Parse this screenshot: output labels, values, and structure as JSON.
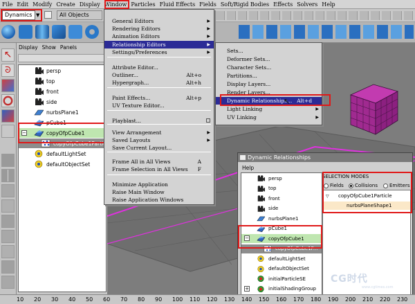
{
  "menubar": {
    "items": [
      "File",
      "Edit",
      "Modify",
      "Create",
      "Display",
      "Window",
      "Particles",
      "Fluid Effects",
      "Fields",
      "Soft/Rigid Bodies",
      "Effects",
      "Solvers",
      "Help"
    ]
  },
  "toolbar": {
    "mode_value": "Dynamics",
    "selection_mask": "All Objects"
  },
  "outliner": {
    "menu": [
      "Display",
      "Show",
      "Panels"
    ],
    "items": [
      {
        "label": "persp",
        "icon": "camera-icon"
      },
      {
        "label": "top",
        "icon": "camera-icon"
      },
      {
        "label": "front",
        "icon": "camera-icon"
      },
      {
        "label": "side",
        "icon": "camera-icon"
      },
      {
        "label": "nurbsPlane1",
        "icon": "nurbs-plane-icon"
      },
      {
        "label": "pCube1",
        "icon": "poly-mesh-icon"
      },
      {
        "label": "copyOfpCube1",
        "icon": "poly-mesh-icon",
        "expander": "−"
      },
      {
        "label": "copyOfpCube1Particle",
        "icon": "particle-icon"
      },
      {
        "label": "defaultLightSet",
        "icon": "set-icon"
      },
      {
        "label": "defaultObjectSet",
        "icon": "set-icon"
      }
    ]
  },
  "window_menu": {
    "items": [
      {
        "label": "General Editors",
        "submenu": true
      },
      {
        "label": "Rendering Editors",
        "submenu": true
      },
      {
        "label": "Animation Editors",
        "submenu": true
      },
      {
        "label": "Relationship Editors",
        "submenu": true,
        "highlighted": true
      },
      {
        "label": "Settings/Preferences",
        "submenu": true
      },
      {
        "label": "Attribute Editor..."
      },
      {
        "label": "Outliner...",
        "shortcut": "Alt+o"
      },
      {
        "label": "Hypergraph...",
        "shortcut": "Alt+h"
      },
      {
        "label": "Paint Effects...",
        "shortcut": "Alt+p"
      },
      {
        "label": "UV Texture Editor..."
      },
      {
        "label": "Playblast...",
        "option_box": true
      },
      {
        "label": "View Arrangement",
        "submenu": true
      },
      {
        "label": "Saved Layouts",
        "submenu": true
      },
      {
        "label": "Save Current Layout..."
      },
      {
        "label": "Frame All in All Views",
        "shortcut": "A"
      },
      {
        "label": "Frame Selection in All Views",
        "shortcut": "F"
      },
      {
        "label": "Minimize Application"
      },
      {
        "label": "Raise Main Window"
      },
      {
        "label": "Raise Application Windows"
      }
    ]
  },
  "relationship_submenu": {
    "items": [
      {
        "label": "Sets..."
      },
      {
        "label": "Deformer Sets..."
      },
      {
        "label": "Character Sets..."
      },
      {
        "label": "Partitions..."
      },
      {
        "label": "Display Layers..."
      },
      {
        "label": "Render Layers..."
      },
      {
        "label": "Dynamic Relationships...",
        "shortcut": "Alt+d",
        "highlighted": true
      },
      {
        "label": "Light Linking",
        "submenu": true
      },
      {
        "label": "UV Linking",
        "submenu": true
      }
    ]
  },
  "dynamic_window": {
    "title": "Dynamic Relationships",
    "menu_help": "Help",
    "list": [
      {
        "label": "persp",
        "icon": "camera-icon"
      },
      {
        "label": "top",
        "icon": "camera-icon"
      },
      {
        "label": "front",
        "icon": "camera-icon"
      },
      {
        "label": "side",
        "icon": "camera-icon"
      },
      {
        "label": "nurbsPlane1",
        "icon": "nurbs-plane-icon"
      },
      {
        "label": "pCube1",
        "icon": "poly-mesh-icon"
      },
      {
        "label": "copyOfpCube1",
        "icon": "poly-mesh-icon",
        "expander": "−"
      },
      {
        "label": "copyOfpCube1P...",
        "icon": "particle-icon"
      },
      {
        "label": "defaultLightSet",
        "icon": "set-icon"
      },
      {
        "label": "defaultObjectSet",
        "icon": "set-icon"
      },
      {
        "label": "initialParticleSE",
        "icon": "shading-group-icon"
      },
      {
        "label": "initialShadingGroup",
        "icon": "shading-group-icon",
        "expander": "+"
      }
    ],
    "selection_modes": {
      "title": "SELECTION MODES",
      "options": [
        {
          "label": "Fields",
          "selected": false
        },
        {
          "label": "Collisions",
          "selected": true
        },
        {
          "label": "Emitters",
          "selected": false
        }
      ],
      "tree": [
        {
          "label": "copyOfpCube1Particle",
          "expander": "▽"
        },
        {
          "label": "nurbsPlaneShape1"
        }
      ]
    }
  },
  "timeline": {
    "ticks": [
      "10",
      "20",
      "30",
      "40",
      "50",
      "60",
      "70",
      "80",
      "90",
      "100",
      "110",
      "120",
      "130",
      "140",
      "150",
      "160",
      "170",
      "180",
      "190",
      "200",
      "210",
      "220",
      "230"
    ]
  },
  "watermark": {
    "brand": "CG时代",
    "url": "www.cgtimes.com"
  },
  "colors": {
    "highlight": "#2b2b96",
    "annotation_red": "#e01818",
    "selection_green": "#bfe6b0",
    "magenta_wire": "#e030e0"
  }
}
